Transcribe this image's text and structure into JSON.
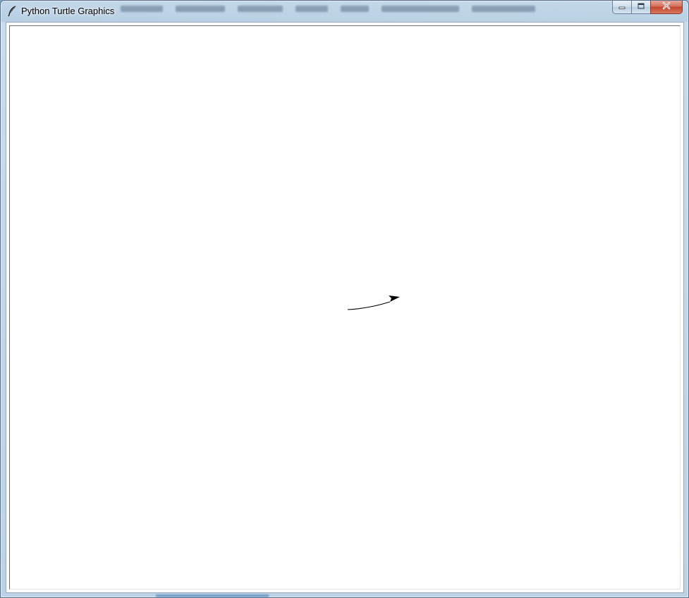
{
  "window": {
    "title": "Python Turtle Graphics",
    "app_icon": "feather-icon",
    "controls": {
      "minimize_icon": "minimize-icon",
      "maximize_icon": "maximize-icon",
      "close_icon": "close-icon"
    }
  },
  "canvas": {
    "background": "#ffffff",
    "turtle": {
      "shape": "classic-arrow",
      "pen_color": "#000000",
      "heading": "north-east"
    }
  },
  "colors": {
    "titlebar": "#c4d8ea",
    "close_button": "#c2462e",
    "canvas": "#ffffff"
  }
}
